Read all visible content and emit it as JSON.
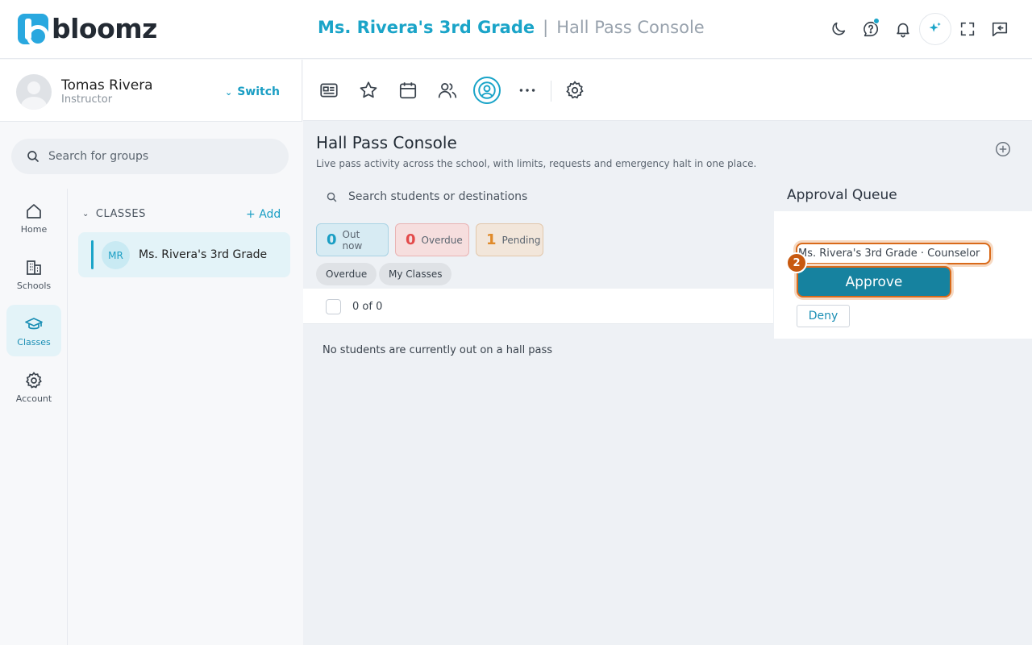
{
  "brand": {
    "name": "bloomz",
    "accent": "#1aa4c8"
  },
  "header": {
    "class_name": "Ms. Rivera's 3rd Grade",
    "separator": "|",
    "page": "Hall Pass Console",
    "icons": [
      "moon-icon",
      "help-icon",
      "bell-icon",
      "sparkle-icon",
      "fullscreen-icon",
      "message-icon"
    ]
  },
  "profile": {
    "name": "Tomas Rivera",
    "role": "Instructor",
    "switch_label": "Switch"
  },
  "left_search": {
    "placeholder": "Search for groups"
  },
  "rail": {
    "items": [
      {
        "label": "Home",
        "icon": "home-icon"
      },
      {
        "label": "Schools",
        "icon": "building-icon"
      },
      {
        "label": "Classes",
        "icon": "graduation-cap-icon",
        "active": true
      },
      {
        "label": "Account",
        "icon": "gear-icon"
      }
    ]
  },
  "classes": {
    "heading": "CLASSES",
    "add_label": "Add",
    "items": [
      {
        "initials": "MR",
        "name": "Ms. Rivera's 3rd Grade"
      }
    ]
  },
  "toolbar": {
    "icons": [
      "newspaper-icon",
      "star-icon",
      "calendar-icon",
      "people-icon",
      "user-circle-icon",
      "more-icon",
      "settings-icon"
    ],
    "active": "user-circle-icon"
  },
  "main": {
    "title": "Hall Pass Console",
    "description": "Live pass activity across the school, with limits, requests and emergency halt in one place.",
    "search_placeholder": "Search students or destinations",
    "stats": [
      {
        "value": "0",
        "label": "Out now",
        "color": "#1a9ec4"
      },
      {
        "value": "0",
        "label": "Overdue",
        "color": "#e34a4a"
      },
      {
        "value": "1",
        "label": "Pending",
        "color": "#e08a2a"
      }
    ],
    "filters": [
      "Overdue",
      "My Classes"
    ],
    "count_text": "0 of 0",
    "empty_message": "No students are currently out on a hall pass"
  },
  "approval_queue": {
    "title": "Approval Queue",
    "request_text": "Ms. Rivera's 3rd Grade · Counselor",
    "approve_label": "Approve",
    "deny_label": "Deny",
    "step_badge": "2",
    "highlight_color": "#d96a1a"
  }
}
